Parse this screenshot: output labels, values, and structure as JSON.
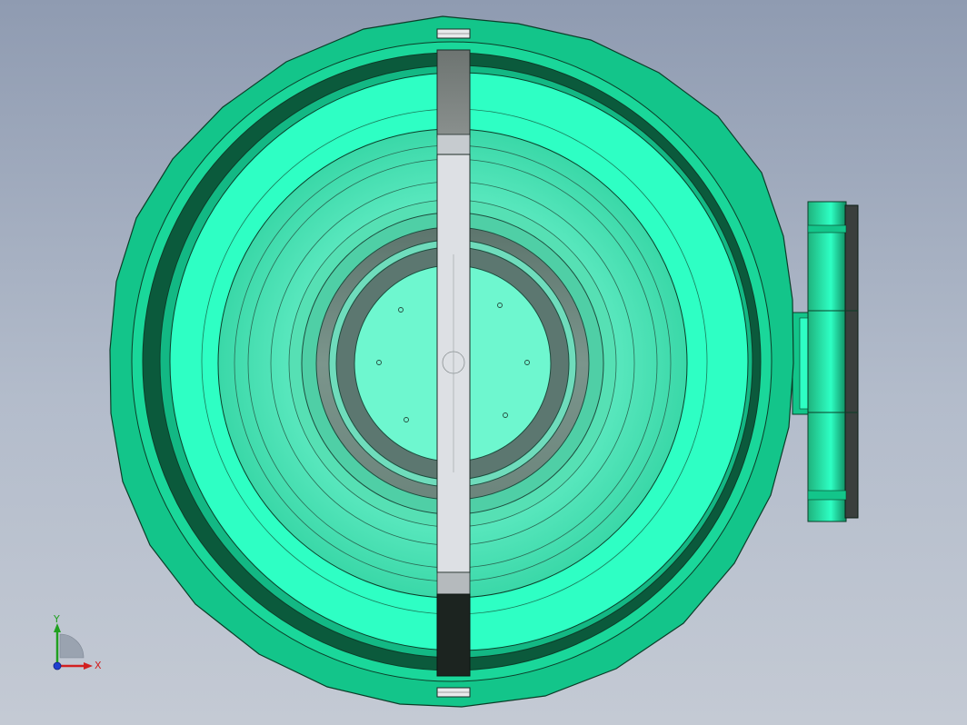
{
  "viewport": {
    "background_top": "#8f9bb1",
    "background_bottom": "#c4cad4"
  },
  "model": {
    "body_color": "#2effc4",
    "dark_green": "#0e8a5c",
    "mid_green": "#13c58a",
    "shadow_green": "#0b5a3c",
    "inner_light": "#6cf6cf",
    "bowl_gray": "#6f8a80",
    "divider_light": "#dcdfe4",
    "divider_dark": "#1a2420"
  },
  "triad": {
    "x_label": "X",
    "y_label": "Y",
    "x_color": "#d22020",
    "y_color": "#20a020",
    "z_color": "#2040d0"
  }
}
